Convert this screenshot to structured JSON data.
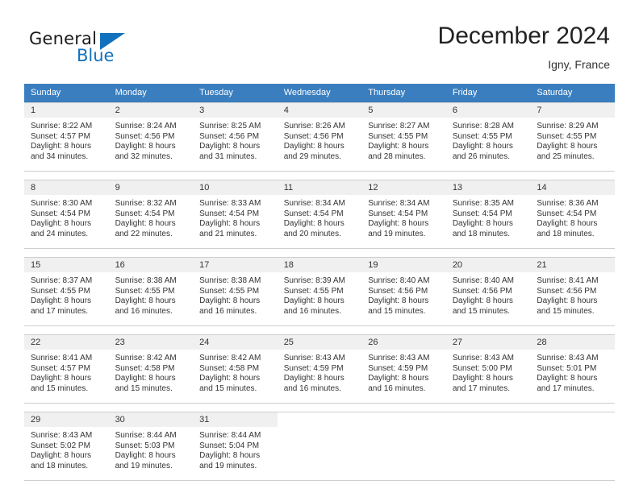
{
  "brand": {
    "name_top": "General",
    "name_bottom": "Blue",
    "triangle_color": "#1271bd"
  },
  "header": {
    "title": "December 2024",
    "subtitle": "Igny, France",
    "header_bg": "#3a7ebf",
    "header_text_color": "#ffffff"
  },
  "weekday_headers": [
    "Sunday",
    "Monday",
    "Tuesday",
    "Wednesday",
    "Thursday",
    "Friday",
    "Saturday"
  ],
  "labels": {
    "sunrise_prefix": "Sunrise:",
    "sunset_prefix": "Sunset:",
    "daylight_prefix": "Daylight:"
  },
  "weeks": [
    [
      {
        "day": "1",
        "sunrise": "Sunrise: 8:22 AM",
        "sunset": "Sunset: 4:57 PM",
        "daylight_line1": "Daylight: 8 hours",
        "daylight_line2": "and 34 minutes."
      },
      {
        "day": "2",
        "sunrise": "Sunrise: 8:24 AM",
        "sunset": "Sunset: 4:56 PM",
        "daylight_line1": "Daylight: 8 hours",
        "daylight_line2": "and 32 minutes."
      },
      {
        "day": "3",
        "sunrise": "Sunrise: 8:25 AM",
        "sunset": "Sunset: 4:56 PM",
        "daylight_line1": "Daylight: 8 hours",
        "daylight_line2": "and 31 minutes."
      },
      {
        "day": "4",
        "sunrise": "Sunrise: 8:26 AM",
        "sunset": "Sunset: 4:56 PM",
        "daylight_line1": "Daylight: 8 hours",
        "daylight_line2": "and 29 minutes."
      },
      {
        "day": "5",
        "sunrise": "Sunrise: 8:27 AM",
        "sunset": "Sunset: 4:55 PM",
        "daylight_line1": "Daylight: 8 hours",
        "daylight_line2": "and 28 minutes."
      },
      {
        "day": "6",
        "sunrise": "Sunrise: 8:28 AM",
        "sunset": "Sunset: 4:55 PM",
        "daylight_line1": "Daylight: 8 hours",
        "daylight_line2": "and 26 minutes."
      },
      {
        "day": "7",
        "sunrise": "Sunrise: 8:29 AM",
        "sunset": "Sunset: 4:55 PM",
        "daylight_line1": "Daylight: 8 hours",
        "daylight_line2": "and 25 minutes."
      }
    ],
    [
      {
        "day": "8",
        "sunrise": "Sunrise: 8:30 AM",
        "sunset": "Sunset: 4:54 PM",
        "daylight_line1": "Daylight: 8 hours",
        "daylight_line2": "and 24 minutes."
      },
      {
        "day": "9",
        "sunrise": "Sunrise: 8:32 AM",
        "sunset": "Sunset: 4:54 PM",
        "daylight_line1": "Daylight: 8 hours",
        "daylight_line2": "and 22 minutes."
      },
      {
        "day": "10",
        "sunrise": "Sunrise: 8:33 AM",
        "sunset": "Sunset: 4:54 PM",
        "daylight_line1": "Daylight: 8 hours",
        "daylight_line2": "and 21 minutes."
      },
      {
        "day": "11",
        "sunrise": "Sunrise: 8:34 AM",
        "sunset": "Sunset: 4:54 PM",
        "daylight_line1": "Daylight: 8 hours",
        "daylight_line2": "and 20 minutes."
      },
      {
        "day": "12",
        "sunrise": "Sunrise: 8:34 AM",
        "sunset": "Sunset: 4:54 PM",
        "daylight_line1": "Daylight: 8 hours",
        "daylight_line2": "and 19 minutes."
      },
      {
        "day": "13",
        "sunrise": "Sunrise: 8:35 AM",
        "sunset": "Sunset: 4:54 PM",
        "daylight_line1": "Daylight: 8 hours",
        "daylight_line2": "and 18 minutes."
      },
      {
        "day": "14",
        "sunrise": "Sunrise: 8:36 AM",
        "sunset": "Sunset: 4:54 PM",
        "daylight_line1": "Daylight: 8 hours",
        "daylight_line2": "and 18 minutes."
      }
    ],
    [
      {
        "day": "15",
        "sunrise": "Sunrise: 8:37 AM",
        "sunset": "Sunset: 4:55 PM",
        "daylight_line1": "Daylight: 8 hours",
        "daylight_line2": "and 17 minutes."
      },
      {
        "day": "16",
        "sunrise": "Sunrise: 8:38 AM",
        "sunset": "Sunset: 4:55 PM",
        "daylight_line1": "Daylight: 8 hours",
        "daylight_line2": "and 16 minutes."
      },
      {
        "day": "17",
        "sunrise": "Sunrise: 8:38 AM",
        "sunset": "Sunset: 4:55 PM",
        "daylight_line1": "Daylight: 8 hours",
        "daylight_line2": "and 16 minutes."
      },
      {
        "day": "18",
        "sunrise": "Sunrise: 8:39 AM",
        "sunset": "Sunset: 4:55 PM",
        "daylight_line1": "Daylight: 8 hours",
        "daylight_line2": "and 16 minutes."
      },
      {
        "day": "19",
        "sunrise": "Sunrise: 8:40 AM",
        "sunset": "Sunset: 4:56 PM",
        "daylight_line1": "Daylight: 8 hours",
        "daylight_line2": "and 15 minutes."
      },
      {
        "day": "20",
        "sunrise": "Sunrise: 8:40 AM",
        "sunset": "Sunset: 4:56 PM",
        "daylight_line1": "Daylight: 8 hours",
        "daylight_line2": "and 15 minutes."
      },
      {
        "day": "21",
        "sunrise": "Sunrise: 8:41 AM",
        "sunset": "Sunset: 4:56 PM",
        "daylight_line1": "Daylight: 8 hours",
        "daylight_line2": "and 15 minutes."
      }
    ],
    [
      {
        "day": "22",
        "sunrise": "Sunrise: 8:41 AM",
        "sunset": "Sunset: 4:57 PM",
        "daylight_line1": "Daylight: 8 hours",
        "daylight_line2": "and 15 minutes."
      },
      {
        "day": "23",
        "sunrise": "Sunrise: 8:42 AM",
        "sunset": "Sunset: 4:58 PM",
        "daylight_line1": "Daylight: 8 hours",
        "daylight_line2": "and 15 minutes."
      },
      {
        "day": "24",
        "sunrise": "Sunrise: 8:42 AM",
        "sunset": "Sunset: 4:58 PM",
        "daylight_line1": "Daylight: 8 hours",
        "daylight_line2": "and 15 minutes."
      },
      {
        "day": "25",
        "sunrise": "Sunrise: 8:43 AM",
        "sunset": "Sunset: 4:59 PM",
        "daylight_line1": "Daylight: 8 hours",
        "daylight_line2": "and 16 minutes."
      },
      {
        "day": "26",
        "sunrise": "Sunrise: 8:43 AM",
        "sunset": "Sunset: 4:59 PM",
        "daylight_line1": "Daylight: 8 hours",
        "daylight_line2": "and 16 minutes."
      },
      {
        "day": "27",
        "sunrise": "Sunrise: 8:43 AM",
        "sunset": "Sunset: 5:00 PM",
        "daylight_line1": "Daylight: 8 hours",
        "daylight_line2": "and 17 minutes."
      },
      {
        "day": "28",
        "sunrise": "Sunrise: 8:43 AM",
        "sunset": "Sunset: 5:01 PM",
        "daylight_line1": "Daylight: 8 hours",
        "daylight_line2": "and 17 minutes."
      }
    ],
    [
      {
        "day": "29",
        "sunrise": "Sunrise: 8:43 AM",
        "sunset": "Sunset: 5:02 PM",
        "daylight_line1": "Daylight: 8 hours",
        "daylight_line2": "and 18 minutes."
      },
      {
        "day": "30",
        "sunrise": "Sunrise: 8:44 AM",
        "sunset": "Sunset: 5:03 PM",
        "daylight_line1": "Daylight: 8 hours",
        "daylight_line2": "and 19 minutes."
      },
      {
        "day": "31",
        "sunrise": "Sunrise: 8:44 AM",
        "sunset": "Sunset: 5:04 PM",
        "daylight_line1": "Daylight: 8 hours",
        "daylight_line2": "and 19 minutes."
      },
      {
        "day": "",
        "sunrise": "",
        "sunset": "",
        "daylight_line1": "",
        "daylight_line2": ""
      },
      {
        "day": "",
        "sunrise": "",
        "sunset": "",
        "daylight_line1": "",
        "daylight_line2": ""
      },
      {
        "day": "",
        "sunrise": "",
        "sunset": "",
        "daylight_line1": "",
        "daylight_line2": ""
      },
      {
        "day": "",
        "sunrise": "",
        "sunset": "",
        "daylight_line1": "",
        "daylight_line2": ""
      }
    ]
  ]
}
